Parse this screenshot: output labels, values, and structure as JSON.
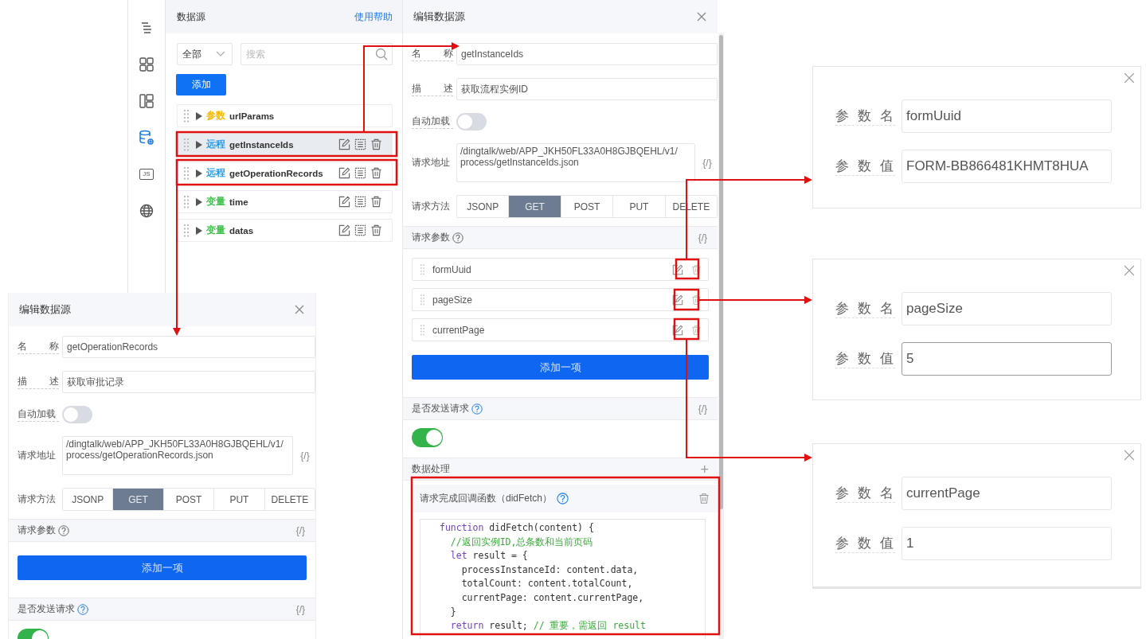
{
  "icon_rail": [
    {
      "kind": "outline",
      "selected": false
    },
    {
      "kind": "components",
      "selected": false
    },
    {
      "kind": "layout",
      "selected": false
    },
    {
      "kind": "datasource",
      "selected": true
    },
    {
      "kind": "js",
      "label": "JS",
      "selected": false
    },
    {
      "kind": "globe",
      "selected": false
    }
  ],
  "datasource_panel": {
    "title": "数据源",
    "help_link": "使用帮助",
    "filter": {
      "value": "全部"
    },
    "search": {
      "placeholder": "搜索"
    },
    "add_button": "添加",
    "items": [
      {
        "type_label": "参数",
        "color": "#f5b800",
        "name": "urlParams",
        "selected": false,
        "show_actions": false
      },
      {
        "type_label": "远程",
        "color": "#1e9bf0",
        "name": "getInstanceIds",
        "selected": true,
        "show_actions": true
      },
      {
        "type_label": "远程",
        "color": "#1e9bf0",
        "name": "getOperationRecords",
        "selected": false,
        "show_actions": true
      },
      {
        "type_label": "变量",
        "color": "#3cc04a",
        "name": "time",
        "selected": false,
        "show_actions": true
      },
      {
        "type_label": "变量",
        "color": "#3cc04a",
        "name": "datas",
        "selected": false,
        "show_actions": true
      }
    ]
  },
  "editors": [
    {
      "title": "编辑数据源",
      "fields": [
        {
          "label": "名称",
          "value": "getInstanceIds"
        },
        {
          "label": "描述",
          "value": "获取流程实例ID"
        }
      ],
      "auto_load": {
        "label": "自动加载",
        "on": false
      },
      "url": {
        "label": "请求地址",
        "lines": [
          "/dingtalk/web/APP_JKH50FL33A0H8GJBQEHL/v1/",
          "process/getInstanceIds.json"
        ],
        "code_icon": "{/}"
      },
      "method": {
        "label": "请求方法",
        "options": [
          {
            "label": "JSONP",
            "selected": false
          },
          {
            "label": "GET",
            "selected": true
          },
          {
            "label": "POST",
            "selected": false
          },
          {
            "label": "PUT",
            "selected": false
          },
          {
            "label": "DELETE",
            "selected": false
          }
        ]
      },
      "params": {
        "title": "请求参数",
        "code_icon": "{/}",
        "items": [
          {
            "name": "formUuid"
          },
          {
            "name": "pageSize"
          },
          {
            "name": "currentPage"
          }
        ],
        "add_button": "添加一项"
      },
      "send_request": {
        "title": "是否发送请求",
        "code_icon": "{/}",
        "on": true
      },
      "data_processing": {
        "title": "数据处理",
        "add": "+",
        "callback_title": "请求完成回调函数（didFetch）",
        "code": [
          [
            {
              "t": "function",
              "kind": "keyword"
            },
            {
              "t": " didFetch(content) {",
              "kind": "plain"
            }
          ],
          [
            {
              "t": "  //返回实例ID,总条数和当前页码",
              "kind": "comment"
            }
          ],
          [
            {
              "t": "  let",
              "kind": "keyword"
            },
            {
              "t": " result = {",
              "kind": "plain"
            }
          ],
          [
            {
              "t": "    processInstanceId: content.data,",
              "kind": "plain"
            }
          ],
          [
            {
              "t": "    totalCount: content.totalCount,",
              "kind": "plain"
            }
          ],
          [
            {
              "t": "    currentPage: content.currentPage,",
              "kind": "plain"
            }
          ],
          [
            {
              "t": "  }",
              "kind": "plain"
            }
          ],
          [
            {
              "t": "  return",
              "kind": "keyword"
            },
            {
              "t": " result; ",
              "kind": "plain"
            },
            {
              "t": "// 重要，需返回 result",
              "kind": "comment"
            }
          ]
        ]
      }
    },
    {
      "title": "编辑数据源",
      "fields": [
        {
          "label": "名称",
          "value": "getOperationRecords"
        },
        {
          "label": "描述",
          "value": "获取审批记录"
        }
      ],
      "auto_load": {
        "label": "自动加载",
        "on": false
      },
      "url": {
        "label": "请求地址",
        "lines": [
          "/dingtalk/web/APP_JKH50FL33A0H8GJBQEHL/v1/",
          "process/getOperationRecords.json"
        ],
        "code_icon": "{/}"
      },
      "method": {
        "label": "请求方法",
        "options": [
          {
            "label": "JSONP",
            "selected": false
          },
          {
            "label": "GET",
            "selected": true
          },
          {
            "label": "POST",
            "selected": false
          },
          {
            "label": "PUT",
            "selected": false
          },
          {
            "label": "DELETE",
            "selected": false
          }
        ]
      },
      "params": {
        "title": "请求参数",
        "code_icon": "{/}",
        "add_button": "添加一项"
      },
      "send_request": {
        "title": "是否发送请求",
        "code_icon": "{/}",
        "on": true
      }
    }
  ],
  "param_dialogs": [
    {
      "name_label": "参数名",
      "name_value": "formUuid",
      "value_label": "参数值",
      "value": "FORM-BB866481KHMT8HUA",
      "focused": false
    },
    {
      "name_label": "参数名",
      "name_value": "pageSize",
      "value_label": "参数值",
      "value": "5",
      "focused": true
    },
    {
      "name_label": "参数名",
      "name_value": "currentPage",
      "value_label": "参数值",
      "value": "1",
      "focused": false
    }
  ]
}
